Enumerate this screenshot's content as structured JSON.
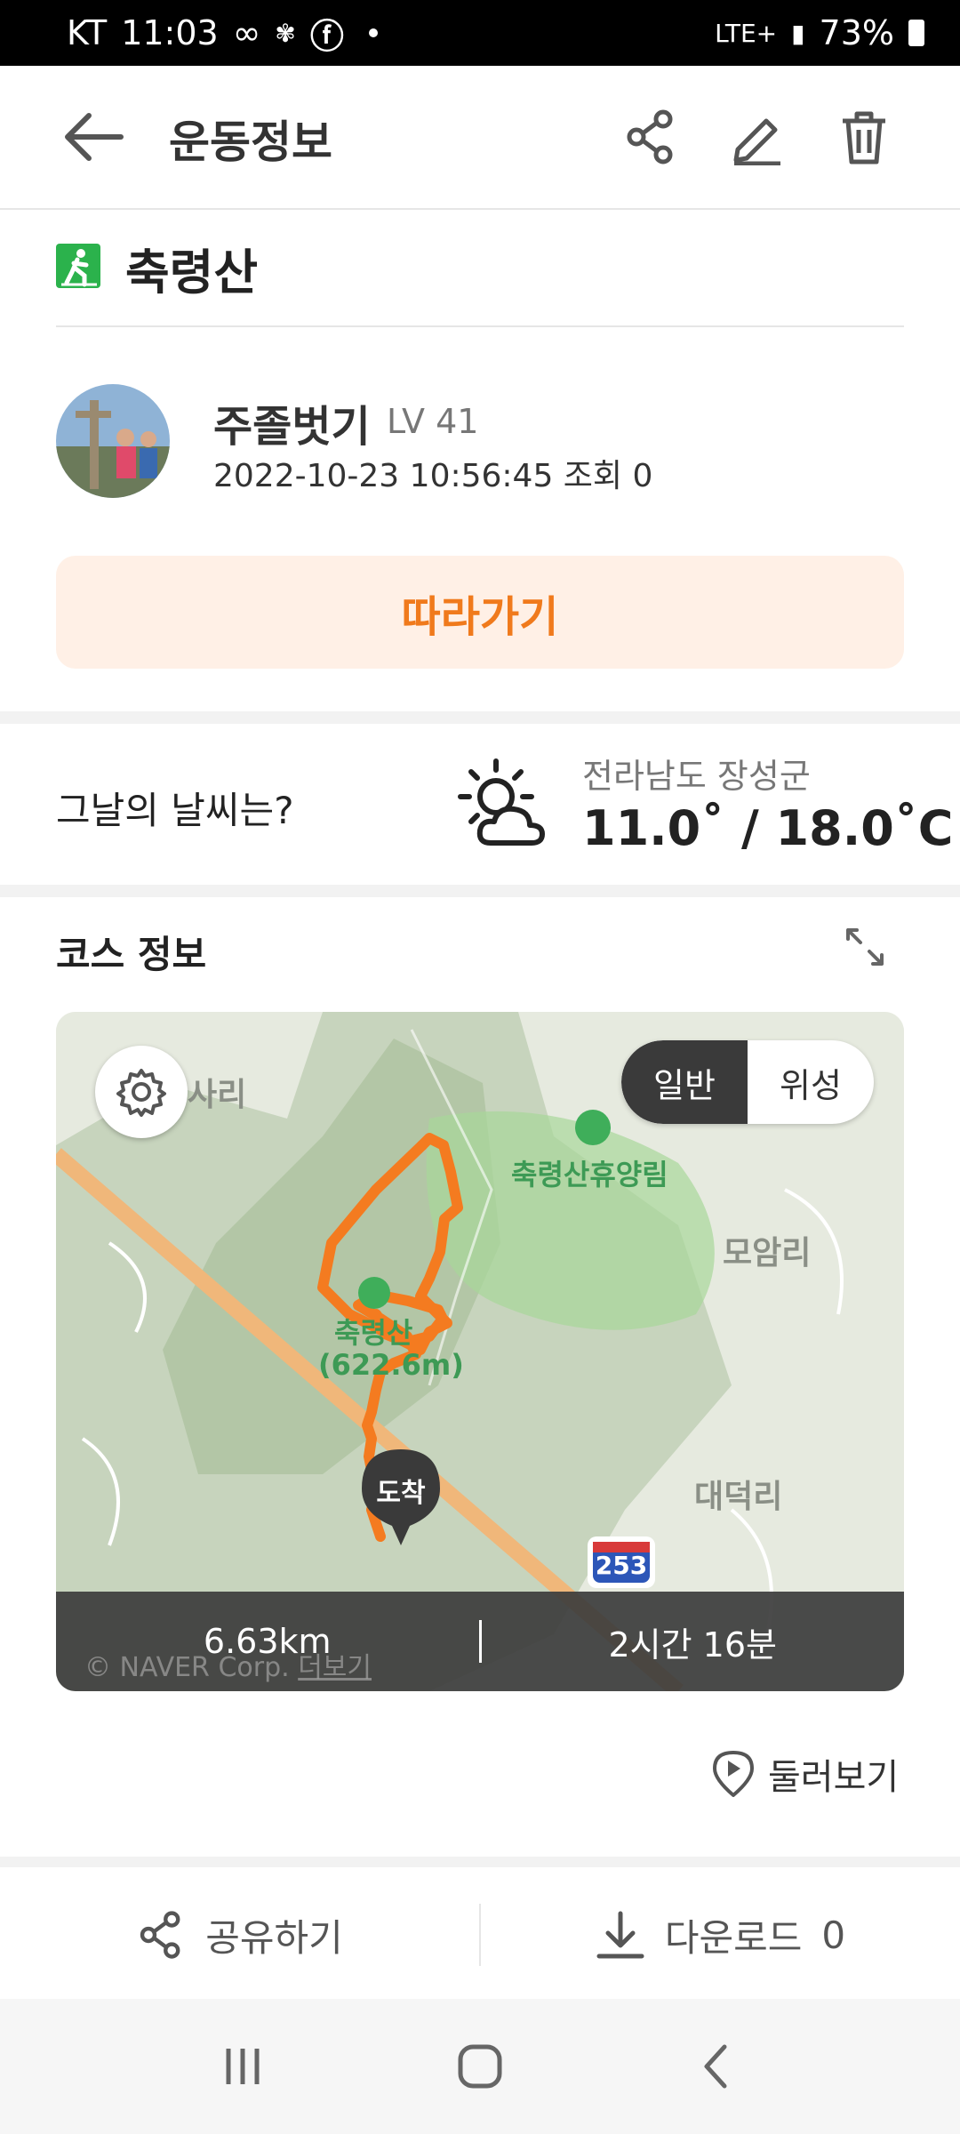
{
  "status_bar": {
    "carrier": "KT",
    "time": "11:03",
    "network": "LTE+",
    "battery": "73%"
  },
  "header": {
    "title": "운동정보",
    "icons": [
      "back-arrow-icon",
      "share-icon",
      "edit-pencil-icon",
      "trash-icon"
    ]
  },
  "course": {
    "activity_icon": "hiking-icon",
    "name": "축령산"
  },
  "author": {
    "name": "주졸벗기",
    "level": "LV 41",
    "datetime": "2022-10-23 10:56:45",
    "views_label": "조회",
    "views": "0"
  },
  "follow_button": "따라가기",
  "weather": {
    "question": "그날의 날씨는?",
    "icon": "partly-cloudy-icon",
    "region": "전라남도 장성군",
    "temperature": "11.0˚ / 18.0˚C"
  },
  "course_info": {
    "title": "코스 정보",
    "map": {
      "mode_options": [
        "일반",
        "위성"
      ],
      "selected_mode": "일반",
      "labels": {
        "place_1": "사리",
        "forest": "축령산휴양림",
        "village_1": "모암리",
        "peak": "축령산",
        "peak_height": "(622.6m)",
        "village_2": "대덕리",
        "route_number": "253"
      },
      "end_marker": "도착",
      "credit": "© NAVER Corp.",
      "credit_link": "더보기",
      "route_color": "#f47b20"
    },
    "distance": "6.63km",
    "duration": "2시간 16분",
    "tour_button": "둘러보기"
  },
  "actions": {
    "share": "공유하기",
    "download_label": "다운로드",
    "download_count": "0"
  },
  "colors": {
    "accent": "#f07a1c",
    "accent_bg": "#fff0e6",
    "hiking_green": "#2bb24c"
  }
}
